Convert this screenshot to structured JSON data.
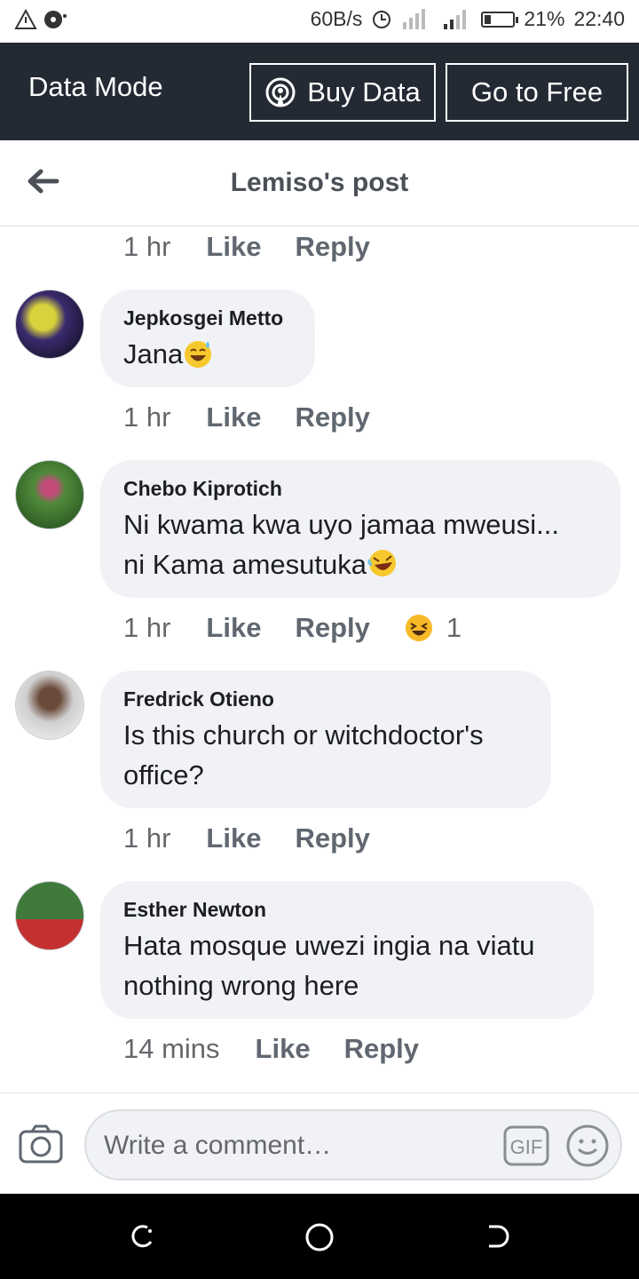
{
  "status_bar": {
    "net_speed": "60B/s",
    "battery": "21%",
    "time": "22:40",
    "battery_level": 0.21
  },
  "data_mode": {
    "title": "Data Mode",
    "buy_label": "Buy Data",
    "free_label": "Go to Free"
  },
  "header": {
    "title": "Lemiso's post"
  },
  "comments": [
    {
      "time": "1 hr",
      "like": "Like",
      "reply": "Reply"
    },
    {
      "name": "Jepkosgei Metto",
      "text": "Jana",
      "time": "1 hr",
      "like": "Like",
      "reply": "Reply",
      "emoji": "sweat-smile"
    },
    {
      "name": "Chebo Kiprotich",
      "line1": "Ni kwama kwa uyo jamaa mweusi...",
      "line2": "ni Kama amesutuka",
      "time": "1 hr",
      "like": "Like",
      "reply": "Reply",
      "reaction_count": "1",
      "emoji": "rofl"
    },
    {
      "name": "Fredrick Otieno",
      "line1": "Is this church or witchdoctor's",
      "line2": "office?",
      "time": "1 hr",
      "like": "Like",
      "reply": "Reply"
    },
    {
      "name": "Esther Newton",
      "line1": "Hata mosque uwezi ingia na viatu",
      "line2": "nothing wrong here",
      "time": "14 mins",
      "like": "Like",
      "reply": "Reply"
    }
  ],
  "composer": {
    "placeholder": "Write a comment…",
    "gif_label": "GIF"
  }
}
